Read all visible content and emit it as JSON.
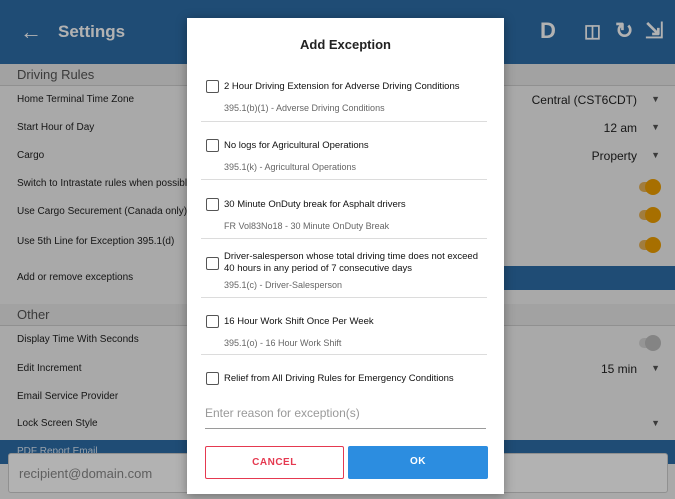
{
  "app": {
    "title": "Settings",
    "toolbar_icons": [
      "D",
      "⎙",
      "↻",
      "↪"
    ],
    "sections": {
      "driving_rules": "Driving Rules",
      "other": "Other"
    },
    "rows": {
      "home_terminal": {
        "label": "Home Terminal Time Zone",
        "value": "Central (CST6CDT)"
      },
      "start_hour": {
        "label": "Start Hour of Day",
        "value": "12 am"
      },
      "cargo": {
        "label": "Cargo",
        "value": "Property"
      },
      "intrastate": {
        "label": "Switch to Intrastate rules when possible (l"
      },
      "cargo_securement": {
        "label": "Use Cargo Securement (Canada only)"
      },
      "fifth_line": {
        "label": "Use 5th Line for Exception 395.1(d)"
      },
      "add_remove": {
        "label": "Add or remove exceptions"
      },
      "display_time": {
        "label": "Display Time With Seconds"
      },
      "edit_increment": {
        "label": "Edit Increment",
        "value": "15 min"
      },
      "email_provider": {
        "label": "Email Service Provider"
      },
      "lock_screen": {
        "label": "Lock Screen Style"
      }
    },
    "pdf_report_label": "PDF Report Email",
    "recipient_placeholder": "recipient@domain.com"
  },
  "dialog": {
    "title": "Add Exception",
    "exceptions": [
      {
        "title": "2 Hour Driving Extension for Adverse Driving Conditions",
        "sub": "395.1(b)(1) - Adverse Driving Conditions"
      },
      {
        "title": "No logs for Agricultural Operations",
        "sub": "395.1(k) - Agricultural Operations"
      },
      {
        "title": "30 Minute OnDuty break for Asphalt drivers",
        "sub": "FR Vol83No18 - 30 Minute OnDuty Break"
      },
      {
        "title": "Driver-salesperson whose total driving time does not exceed 40 hours in any period of 7 consecutive days",
        "sub": "395.1(c) - Driver-Salesperson"
      },
      {
        "title": "16 Hour Work Shift Once Per Week",
        "sub": "395.1(o) - 16 Hour Work Shift"
      },
      {
        "title": "Relief from All Driving Rules for Emergency Conditions",
        "sub": ""
      }
    ],
    "reason_placeholder": "Enter reason for exception(s)",
    "cancel_label": "CANCEL",
    "ok_label": "OK"
  }
}
